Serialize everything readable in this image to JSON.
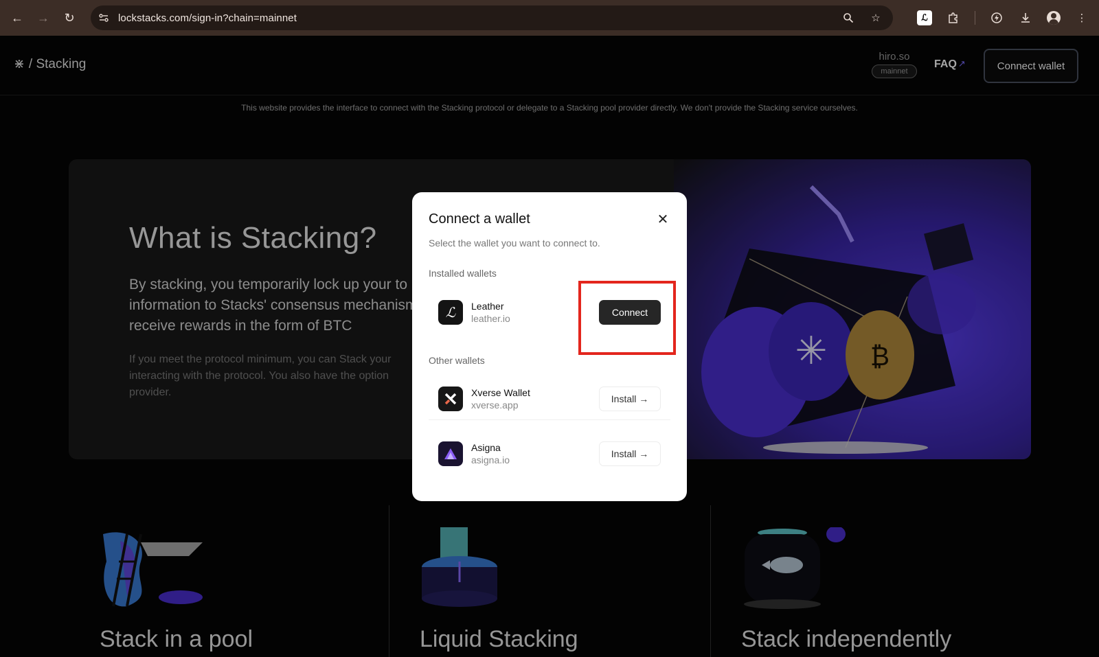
{
  "browser": {
    "url": "lockstacks.com/sign-in?chain=mainnet",
    "icons": [
      "back-icon",
      "forward-icon",
      "reload-icon",
      "site-settings-icon",
      "zoom-icon",
      "bookmark-star-icon",
      "leather-extension-icon",
      "extensions-puzzle-icon",
      "performance-icon",
      "download-icon",
      "profile-icon",
      "menu-icon"
    ]
  },
  "header": {
    "brand": "/ Stacking",
    "network_host": "hiro.so",
    "network_badge": "mainnet",
    "faq": "FAQ",
    "connect_wallet": "Connect wallet"
  },
  "disclaimer": "This website provides the interface to connect with the Stacking protocol or delegate to a Stacking pool provider directly. We don't provide the Stacking service ourselves.",
  "hero": {
    "title": "What is Stacking?",
    "body_lines": [
      "By stacking, you temporarily lock up your to",
      "information to Stacks' consensus mechanism",
      "receive rewards in the form of BTC"
    ],
    "body2_lines": [
      "If you meet the protocol minimum, you can Stack your",
      "interacting with the protocol. You also have the option",
      "provider."
    ]
  },
  "cards": [
    {
      "title": "Stack in a pool"
    },
    {
      "title": "Liquid Stacking"
    },
    {
      "title": "Stack independently"
    }
  ],
  "modal": {
    "title": "Connect a wallet",
    "subtitle": "Select the wallet you want to connect to.",
    "installed_label": "Installed wallets",
    "other_label": "Other wallets",
    "installed": [
      {
        "name": "Leather",
        "domain": "leather.io",
        "action": "Connect"
      }
    ],
    "other": [
      {
        "name": "Xverse Wallet",
        "domain": "xverse.app",
        "action": "Install →"
      },
      {
        "name": "Asigna",
        "domain": "asigna.io",
        "action": "Install →"
      }
    ]
  },
  "colors": {
    "highlight": "#e3261d",
    "hero_accent": "#5a3ff0",
    "faq_arrow": "#7c6cff"
  }
}
